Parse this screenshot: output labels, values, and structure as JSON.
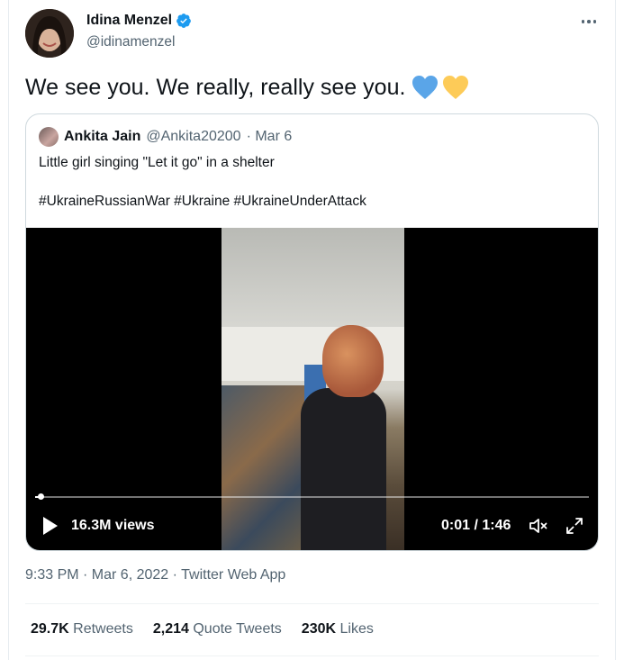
{
  "tweet": {
    "author": {
      "name": "Idina Menzel",
      "handle": "@idinamenzel",
      "verified": true
    },
    "text": "We see you. We really, really see you.",
    "emoji": [
      "blue-heart",
      "yellow-heart"
    ],
    "timestamp": "9:33 PM · Mar 6, 2022 · ",
    "source": "Twitter Web App",
    "stats": {
      "retweets_count": "29.7K",
      "retweets_label": "Retweets",
      "quote_tweets_count": "2,214",
      "quote_tweets_label": "Quote Tweets",
      "likes_count": "230K",
      "likes_label": "Likes"
    }
  },
  "quote": {
    "author": {
      "name": "Ankita Jain",
      "handle": "@Ankita20200",
      "date": "· Mar 6"
    },
    "text": "Little girl singing \"Let it go\" in a shelter",
    "hashtags": "#UkraineRussianWar #Ukraine #UkraineUnderAttack",
    "video": {
      "views": "16.3M views",
      "time": "0:01 / 1:46",
      "progress": 0.01
    }
  },
  "colors": {
    "accent": "#1d9bf0",
    "secondary_text": "#536471",
    "blue_heart": "#5aa5e8",
    "yellow_heart": "#fdcb58"
  }
}
